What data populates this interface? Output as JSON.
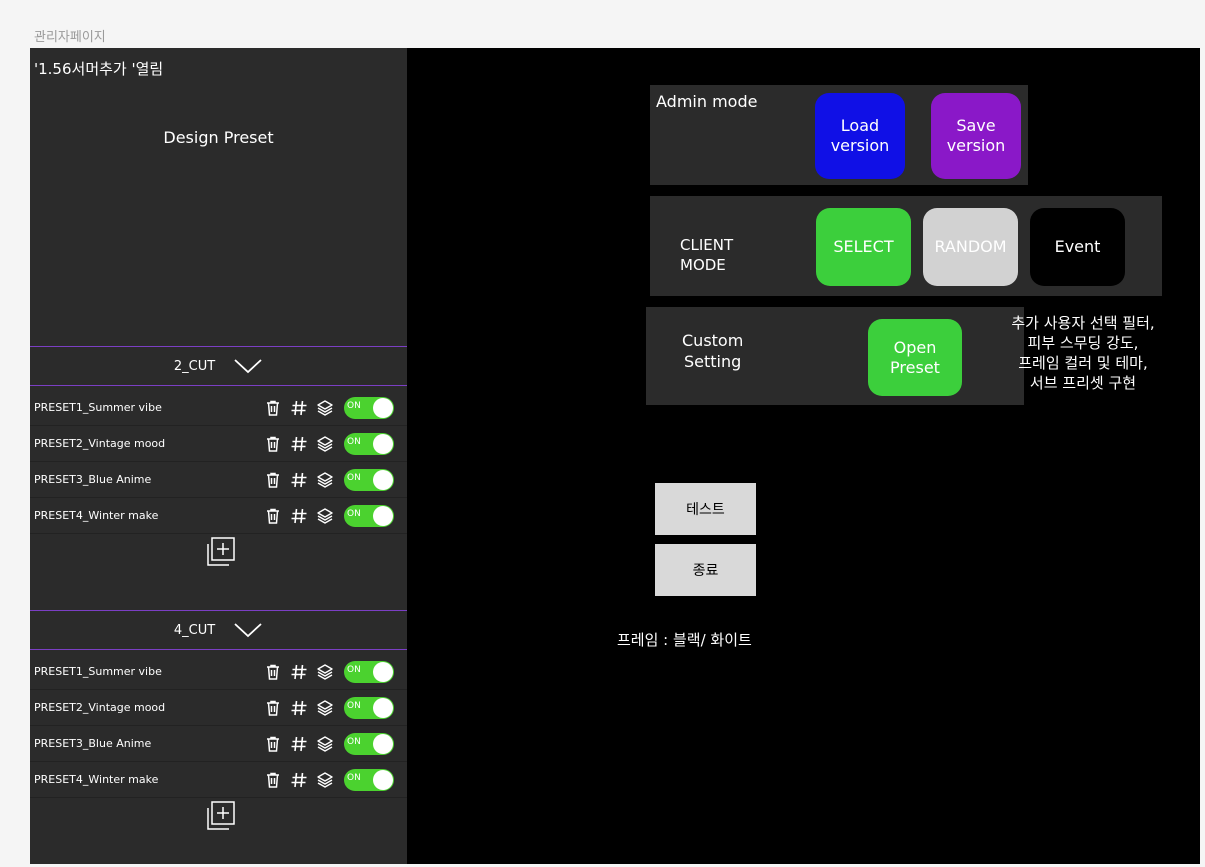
{
  "page_label": "관리자페이지",
  "sidebar": {
    "title": "'1.56서머추가 '열림",
    "design_preset": "Design Preset",
    "groups": [
      {
        "name": "2_CUT",
        "presets": [
          {
            "name": "PRESET1_Summer vibe",
            "toggle": "ON"
          },
          {
            "name": "PRESET2_Vintage mood",
            "toggle": "ON"
          },
          {
            "name": "PRESET3_Blue Anime",
            "toggle": "ON"
          },
          {
            "name": "PRESET4_Winter make",
            "toggle": "ON"
          }
        ]
      },
      {
        "name": "4_CUT",
        "presets": [
          {
            "name": "PRESET1_Summer vibe",
            "toggle": "ON"
          },
          {
            "name": "PRESET2_Vintage mood",
            "toggle": "ON"
          },
          {
            "name": "PRESET3_Blue Anime",
            "toggle": "ON"
          },
          {
            "name": "PRESET4_Winter make",
            "toggle": "ON"
          }
        ]
      }
    ]
  },
  "admin": {
    "label": "Admin mode",
    "load_label_1": "Load",
    "load_label_2": "version",
    "save_label_1": "Save",
    "save_label_2": "version"
  },
  "client": {
    "label_1": "CLIENT",
    "label_2": "MODE",
    "select": "SELECT",
    "random": "RANDOM",
    "event": "Event"
  },
  "custom": {
    "label_1": "Custom",
    "label_2": "Setting",
    "open_1": "Open",
    "open_2": "Preset"
  },
  "note": {
    "line1": "추가 사용자 선택 필터,",
    "line2": "피부 스무딩 강도,",
    "line3": "프레임 컬러 및 테마,",
    "line4": "서브 프리셋 구현"
  },
  "test_button": "테스트",
  "exit_button": "종료",
  "frame_caption": "프레임 : 블랙/ 화이트",
  "colors": {
    "accent_purple": "#7b3fc4",
    "load_blue": "#1010e6",
    "save_purple": "#8a18c8",
    "select_green": "#3ccf3c",
    "random_grey": "#d2d2d2",
    "toggle_green": "#4bd22f"
  }
}
